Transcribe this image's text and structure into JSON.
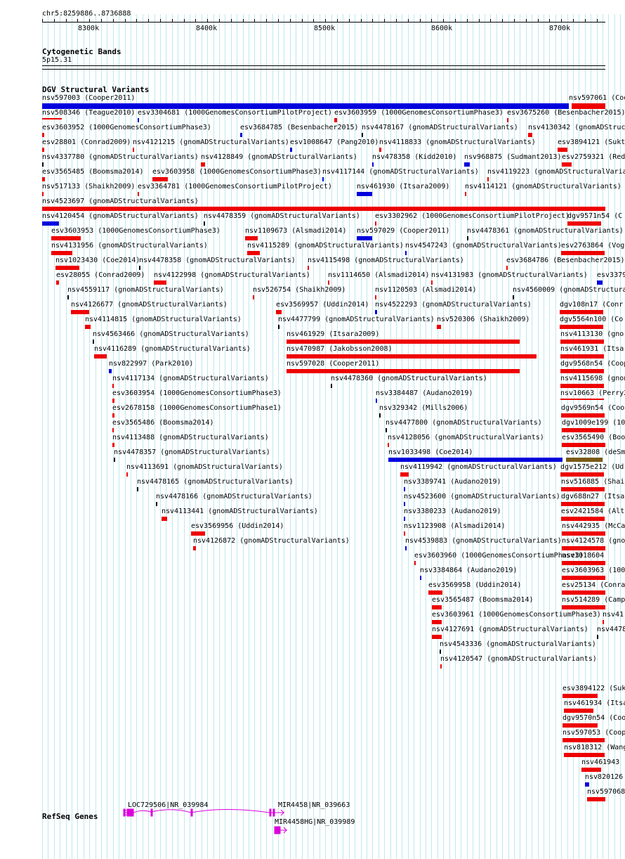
{
  "header": {
    "position": "chr5:8259886..8736888"
  },
  "ruler": {
    "ticks": [
      "8300k",
      "8400k",
      "8500k",
      "8600k",
      "8700k"
    ]
  },
  "cytoband": {
    "title": "Cytogenetic Bands",
    "band": "5p15.31"
  },
  "dgv": {
    "title": "DGV Structural Variants",
    "colors": {
      "red": "#ee0000",
      "blue": "#0000dd",
      "brown": "#7a5a16",
      "black": "#000000"
    },
    "rows": [
      [
        [
          "nsv597003 (Cooper2011)",
          "blue"
        ],
        [
          "nsv597061 (Coo",
          "red"
        ]
      ],
      [
        [
          "nsv508346 (Teague2010)",
          "red"
        ],
        [
          "esv3304681 (1000GenomesConsortiumPilotProject)",
          "blue"
        ],
        [
          "esv3603959 (1000GenomesConsortiumPhase3)",
          "red"
        ],
        [
          "esv3675260 (Besenbacher2015)",
          "red"
        ]
      ],
      [
        [
          "esv3603952 (1000GenomesConsortiumPhase3)",
          "red"
        ],
        [
          "esv3684785 (Besenbacher2015)",
          "blue"
        ],
        [
          "nsv4478167 (gnomADStructuralVariants)",
          "black"
        ],
        [
          "nsv4130342 (gnomADStruc",
          "red"
        ]
      ],
      [
        [
          "esv28801 (Conrad2009)",
          "red"
        ],
        [
          "nsv4121215 (gnomADStructuralVariants)",
          "red"
        ],
        [
          "esv1008647 (Pang2010)",
          "blue"
        ],
        [
          "nsv4118833 (gnomADStructuralVariants)",
          "red"
        ],
        [
          "esv3894121 (Sukt",
          "red"
        ]
      ],
      [
        [
          "nsv4337780 (gnomADStructuralVariants)",
          "black"
        ],
        [
          "nsv4128849 (gnomADStructuralVariants)",
          "red"
        ],
        [
          "nsv478358 (Kidd2010)",
          "blue"
        ],
        [
          "nsv968875 (Sudmant2013)",
          "blue"
        ],
        [
          "esv2759321 (Red",
          "red"
        ]
      ],
      [
        [
          "esv3565485 (Boomsma2014)",
          "red"
        ],
        [
          "esv3603958 (1000GenomesConsortiumPhase3)",
          "red"
        ],
        [
          "nsv4117144 (gnomADStructuralVariants)",
          "blue"
        ],
        [
          "nsv4119223 (gnomADStructuralVariants)",
          "red"
        ]
      ],
      [
        [
          "nsv517133 (Shaikh2009)",
          "red"
        ],
        [
          "esv3364781 (1000GenomesConsortiumPilotProject)",
          "red"
        ],
        [
          "nsv461930 (Itsara2009)",
          "blue"
        ],
        [
          "nsv4114121 (gnomADStructuralVariants)",
          "red"
        ]
      ],
      [
        [
          "nsv4523697 (gnomADStructuralVariants)",
          "red"
        ]
      ],
      [
        [
          "nsv4120454 (gnomADStructuralVariants)",
          "blue"
        ],
        [
          "nsv4478359 (gnomADStructuralVariants)",
          "black"
        ],
        [
          "esv3302962 (1000GenomesConsortiumPilotProject)",
          "red"
        ],
        [
          "dgv9571n54 (C",
          "red"
        ]
      ],
      [
        [
          "esv3603953 (1000GenomesConsortiumPhase3)",
          "red"
        ],
        [
          "nsv1109673 (Alsmadi2014)",
          "red"
        ],
        [
          "nsv597029 (Cooper2011)",
          "blue"
        ],
        [
          "nsv4478361 (gnomADStructuralVariants)",
          "black"
        ]
      ],
      [
        [
          "nsv4131956 (gnomADStructuralVariants)",
          "red"
        ],
        [
          "nsv4115289 (gnomADStructuralVariants)",
          "red"
        ],
        [
          "nsv4547243 (gnomADStructuralVariants)",
          "blue"
        ],
        [
          "esv2763864 (Vog",
          "red"
        ]
      ],
      [
        [
          "nsv1023430 (Coe2014)",
          "red"
        ],
        [
          "nsv4478358 (gnomADStructuralVariants)",
          "black"
        ],
        [
          "nsv4115498 (gnomADStructuralVariants)",
          "red"
        ],
        [
          "esv3684786 (Besenbacher2015)",
          "red"
        ]
      ],
      [
        [
          "esv28055 (Conrad2009)",
          "red"
        ],
        [
          "nsv4122998 (gnomADStructuralVariants)",
          "red"
        ],
        [
          "nsv1114650 (Alsmadi2014)",
          "red"
        ],
        [
          "nsv4131983 (gnomADStructuralVariants)",
          "red"
        ],
        [
          "esv3379",
          "blue"
        ]
      ],
      [
        [
          "nsv4559117 (gnomADStructuralVariants)",
          "black"
        ],
        [
          "nsv526754 (Shaikh2009)",
          "red"
        ],
        [
          "nsv1120503 (Alsmadi2014)",
          "red"
        ],
        [
          "nsv4560009 (gnomADStructuralVa",
          "black"
        ]
      ],
      [
        [
          "nsv4126677 (gnomADStructuralVariants)",
          "red"
        ],
        [
          "esv3569957 (Uddin2014)",
          "red"
        ],
        [
          "nsv4522293 (gnomADStructuralVariants)",
          "blue"
        ],
        [
          "dgv108n17 (Conr",
          "red"
        ]
      ],
      [
        [
          "nsv4114815 (gnomADStructuralVariants)",
          "red"
        ],
        [
          "nsv4477799 (gnomADStructuralVariants)",
          "black"
        ],
        [
          "nsv520306 (Shaikh2009)",
          "red"
        ],
        [
          "dgv5564n100 (Co",
          "red"
        ]
      ],
      [
        [
          "nsv4563466 (gnomADStructuralVariants)",
          "black"
        ],
        [
          "nsv461929 (Itsara2009)",
          "red"
        ],
        [
          "nsv4113130 (gnor",
          "red"
        ]
      ],
      [
        [
          "nsv4116289 (gnomADStructuralVariants)",
          "red"
        ],
        [
          "nsv470987 (Jakobsson2008)",
          "red"
        ],
        [
          "nsv461931 (Itsar",
          "red"
        ]
      ],
      [
        [
          "nsv822997 (Park2010)",
          "blue"
        ],
        [
          "nsv597028 (Cooper2011)",
          "red"
        ],
        [
          "dgv9568n54 (Coop",
          "red"
        ]
      ],
      [
        [
          "nsv4117134 (gnomADStructuralVariants)",
          "red"
        ],
        [
          "nsv4478360 (gnomADStructuralVariants)",
          "black"
        ],
        [
          "nsv4115698 (gnon",
          "red"
        ]
      ],
      [
        [
          "esv3603954 (1000GenomesConsortiumPhase3)",
          "red"
        ],
        [
          "nsv3384487 (Audano2019)",
          "blue"
        ],
        [
          "nsv10663 (Perry2",
          "red"
        ]
      ],
      [
        [
          "esv2678158 (1000GenomesConsortiumPhase1)",
          "red"
        ],
        [
          "nsv329342 (Mills2006)",
          "black"
        ],
        [
          "dgv9569n54 (Coo",
          "red"
        ]
      ],
      [
        [
          "esv3565486 (Boomsma2014)",
          "red"
        ],
        [
          "nsv4477800 (gnomADStructuralVariants)",
          "black"
        ],
        [
          "dgv1009e199 (10",
          "red"
        ]
      ],
      [
        [
          "nsv4113488 (gnomADStructuralVariants)",
          "red"
        ],
        [
          "nsv4128056 (gnomADStructuralVariants)",
          "red"
        ],
        [
          "esv3565490 (Boo",
          "red"
        ]
      ],
      [
        [
          "nsv4478357 (gnomADStructuralVariants)",
          "black"
        ],
        [
          "nsv1033498 (Coe2014)",
          "blue"
        ],
        [
          "esv32808 (deSm",
          "brown"
        ]
      ],
      [
        [
          "nsv4113691 (gnomADStructuralVariants)",
          "red"
        ],
        [
          "nsv4119942 (gnomADStructuralVariants)",
          "red"
        ],
        [
          "dgv1575e212 (Ud",
          "red"
        ]
      ],
      [
        [
          "nsv4478165 (gnomADStructuralVariants)",
          "black"
        ],
        [
          "nsv3389741 (Audano2019)",
          "blue"
        ],
        [
          "nsv516885 (Shai",
          "red"
        ]
      ],
      [
        [
          "nsv4478166 (gnomADStructuralVariants)",
          "black"
        ],
        [
          "nsv4523600 (gnomADStructuralVariants)",
          "blue"
        ],
        [
          "dgv688n27 (Itsa",
          "red"
        ]
      ],
      [
        [
          "nsv4113441 (gnomADStructuralVariants)",
          "red"
        ],
        [
          "nsv3380233 (Audano2019)",
          "blue"
        ],
        [
          "esv2421584 (Alt",
          "red"
        ]
      ],
      [
        [
          "esv3569956 (Uddin2014)",
          "red"
        ],
        [
          "nsv1123908 (Alsmadi2014)",
          "red"
        ],
        [
          "nsv442935 (McCa",
          "red"
        ]
      ],
      [
        [
          "nsv4126872 (gnomADStructuralVariants)",
          "red"
        ],
        [
          "nsv4539883 (gnomADStructuralVariants)",
          "blue"
        ],
        [
          "nsv4124578 (gno",
          "red"
        ]
      ],
      [
        [
          "esv3603960 (1000GenomesConsortiumPhase3)",
          "red"
        ],
        [
          "nsv1018604",
          "red"
        ]
      ],
      [
        [
          "nsv3384864 (Audano2019)",
          "blue"
        ],
        [
          "esv3603963 (100",
          "red"
        ]
      ],
      [
        [
          "esv3569958 (Uddin2014)",
          "red"
        ],
        [
          "esv25134 (Conra",
          "red"
        ]
      ],
      [
        [
          "esv3565487 (Boomsma2014)",
          "red"
        ],
        [
          "nsv514289 (Camp",
          "red"
        ]
      ],
      [
        [
          "esv3603961 (1000GenomesConsortiumPhase3)",
          "red"
        ],
        [
          "nsv41",
          "red"
        ]
      ],
      [
        [
          "nsv4127691 (gnomADStructuralVariants)",
          "red"
        ],
        [
          "nsv4478",
          "black"
        ]
      ],
      [
        [
          "nsv4543336 (gnomADStructuralVariants)",
          "black"
        ]
      ],
      [
        [
          "nsv4120547 (gnomADStructuralVariants)",
          "red"
        ]
      ],
      [],
      [
        [
          "esv3894122 (Suk",
          "red"
        ]
      ],
      [
        [
          "nsv461934 (Itsa",
          "red"
        ]
      ],
      [
        [
          "dgv9570n54 (Coo",
          "red"
        ]
      ],
      [
        [
          "nsv597053 (Coop",
          "red"
        ]
      ],
      [
        [
          "nsv818312 (Wang",
          "red"
        ]
      ],
      [
        [
          "nsv461943",
          "red"
        ]
      ],
      [
        [
          "nsv820126",
          "blue"
        ]
      ],
      [
        [
          "nsv597068",
          "red"
        ]
      ]
    ]
  },
  "refseq": {
    "title": "RefSeq Genes",
    "genes": [
      "LOC729506|NR_039984",
      "MIR4458|NR_039663",
      "MIR4458HG|NR_039989"
    ],
    "color": "#dd00dd"
  }
}
